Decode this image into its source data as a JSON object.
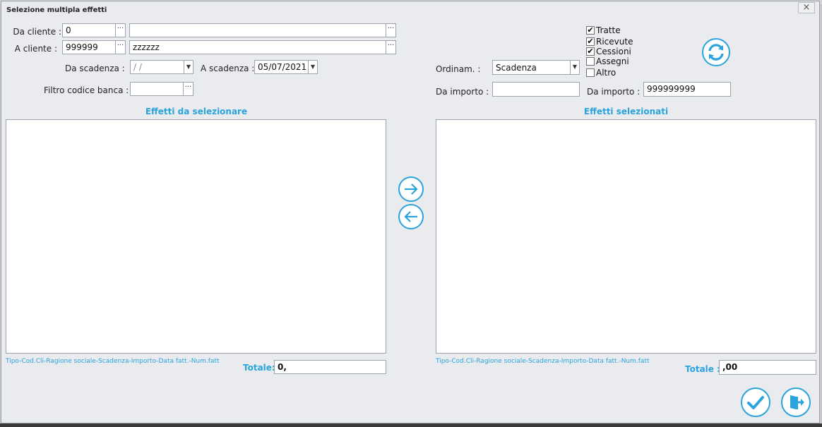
{
  "window": {
    "title": "Selezione multipla effetti",
    "close": "×"
  },
  "filters": {
    "da_cliente_label": "Da cliente :",
    "da_cliente_code": "0",
    "da_cliente_name": "",
    "a_cliente_label": "A cliente :",
    "a_cliente_code": "999999",
    "a_cliente_name": "zzzzzz",
    "da_scadenza_label": "Da scadenza :",
    "da_scadenza_value": " /  /",
    "a_scadenza_label": "A scadenza :",
    "a_scadenza_value": "05/07/2021",
    "filtro_banca_label": "Filtro codice banca :",
    "filtro_banca_value": "",
    "ellipsis": "···"
  },
  "types": {
    "tratte": {
      "label": "Tratte",
      "checked": true
    },
    "ricevute": {
      "label": "Ricevute",
      "checked": true
    },
    "cessioni": {
      "label": "Cessioni",
      "checked": true
    },
    "assegni": {
      "label": "Assegni",
      "checked": false
    },
    "altro": {
      "label": "Altro",
      "checked": false
    },
    "checkmark": "✔"
  },
  "sorting": {
    "ordinam_label": "Ordinam. :",
    "ordinam_value": "Scadenza",
    "da_importo_label": "Da importo :",
    "da_importo_value": "",
    "a_importo_label": "Da importo :",
    "a_importo_value": "999999999"
  },
  "left_panel": {
    "title": "Effetti da selezionare",
    "columns": "Tipo-Cod.Cli-Ragione sociale-Scadenza-Importo-Data fatt.-Num.fatt",
    "totale_label": "Totale:",
    "totale_value": "0,"
  },
  "right_panel": {
    "title": "Effetti selezionati",
    "columns": "Tipo-Cod.Cli-Ragione sociale-Scadenza-Importo-Data fatt.-Num.fatt",
    "totale_label": "Totale :",
    "totale_value": ",00"
  },
  "colors": {
    "accent": "#2ba3dc",
    "background": "#e9ebee"
  },
  "icons": {
    "refresh": "refresh-icon",
    "move_right": "arrow-right-icon",
    "move_left": "arrow-left-icon",
    "confirm": "checkmark-icon",
    "exit": "exit-door-icon"
  }
}
